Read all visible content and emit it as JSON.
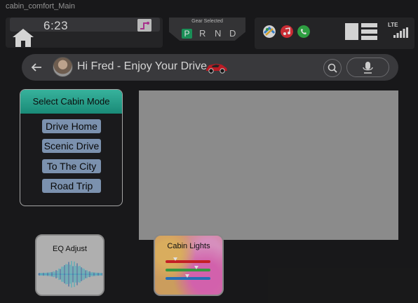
{
  "window": {
    "title": "cabin_comfort_Main"
  },
  "header": {
    "time": "6:23"
  },
  "gear": {
    "title": "Gear Selected",
    "items": [
      "P",
      "R",
      "N",
      "D"
    ],
    "selected": "P"
  },
  "status": {
    "network": "LTE",
    "apps": [
      "maps-icon",
      "music-icon",
      "phone-icon"
    ]
  },
  "search_bar": {
    "greeting": "Hi Fred - Enjoy Your Drive"
  },
  "cabin_mode": {
    "title": "Select Cabin Mode",
    "options": [
      "Drive Home",
      "Scenic Drive",
      "To The City",
      "Road Trip"
    ]
  },
  "widgets": {
    "eq_label": "EQ Adjust",
    "lights_label": "Cabin Lights",
    "light_levels": [
      0.22,
      0.68,
      0.48
    ],
    "light_colors": [
      "#e0242b",
      "#3fae4a",
      "#2a7fd0"
    ]
  },
  "colors": {
    "accent_teal": "#2eb59c",
    "gear_active": "#1ea364",
    "mode_button": "#8ca6c7"
  }
}
